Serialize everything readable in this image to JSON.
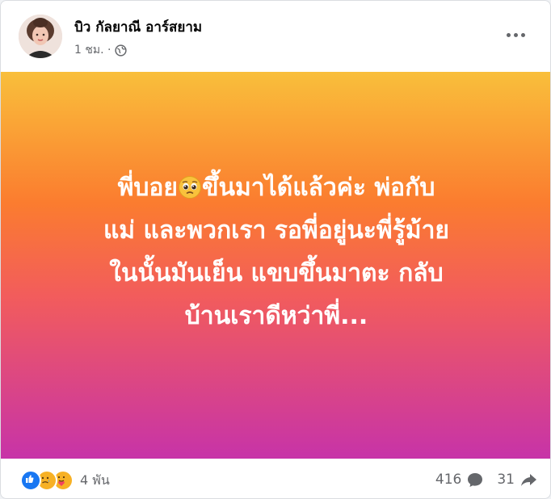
{
  "post": {
    "author": "บิว กัลยาณี อาร์สยาม",
    "time": "1 ชม. ·",
    "privacy_icon": "globe-icon",
    "text_lines": [
      "พี่บอย",
      "ขึ้นมาได้แล้วค่ะ พ่อกับ",
      "แม่ และพวกเรา รอพี่อยู่นะพี่รู้ม้าย",
      "ในนั้นมันเย็น แขบขึ้นมาตะ กลับ",
      "บ้านเราดีหว่าพี่..."
    ],
    "inline_emoji": "pleading-face-emoji",
    "background_colors": [
      "#f9bf3b",
      "#fb7c2f",
      "#f25c5c",
      "#c733a8"
    ]
  },
  "footer": {
    "reaction_icons": [
      "like-icon",
      "sad-icon",
      "care-icon"
    ],
    "reaction_count": "4 พัน",
    "comments_count": "416",
    "shares_count": "31"
  }
}
